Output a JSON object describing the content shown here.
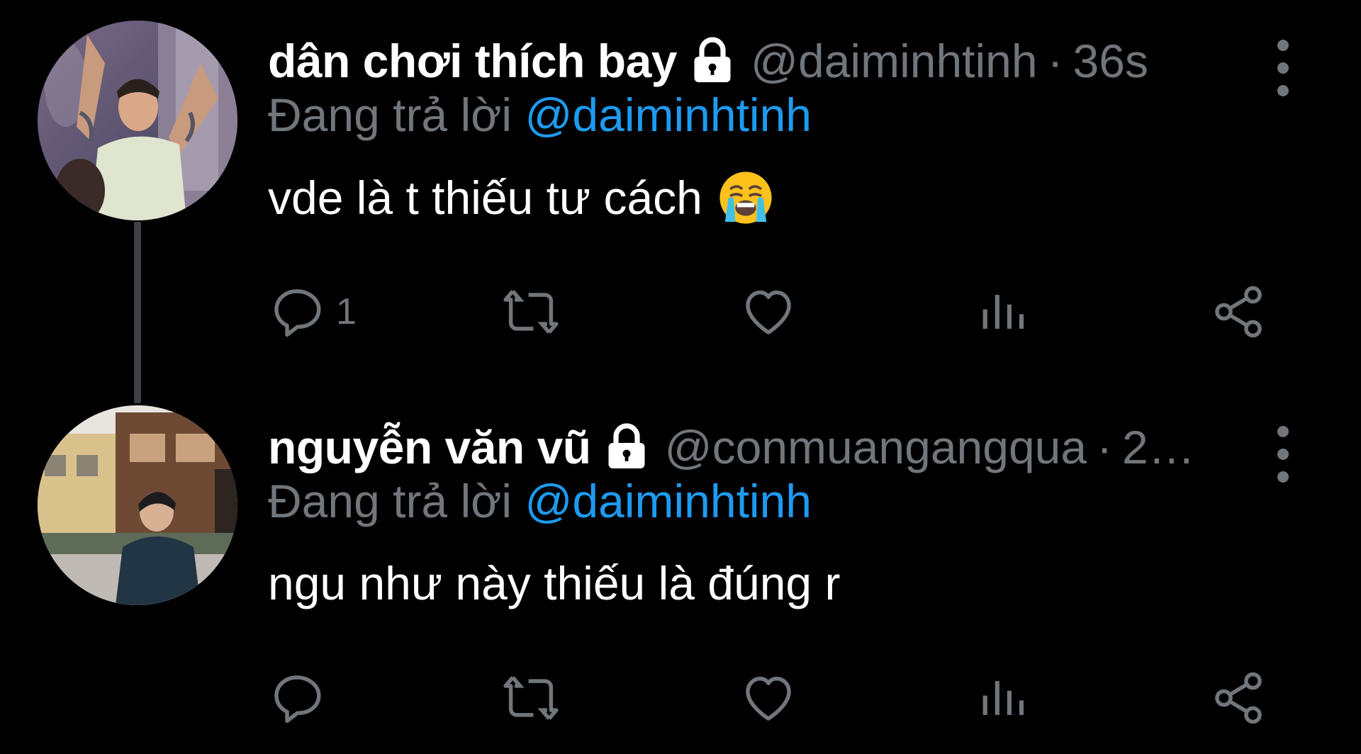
{
  "tweets": [
    {
      "display_name": "dân chơi thích bay",
      "handle": "@daiminhtinh",
      "separator": "·",
      "time": "36s",
      "reply_prefix": "Đang trả lời",
      "reply_to": "@daiminhtinh",
      "text": "vde là t thiếu tư cách",
      "emoji": "loudly-crying-face",
      "reply_count": "1",
      "protected": true
    },
    {
      "display_name": "nguyễn văn vũ",
      "handle": "@conmuangangqua",
      "separator": "·",
      "time": "2…",
      "reply_prefix": "Đang trả lời",
      "reply_to": "@daiminhtinh",
      "text": "ngu như này thiếu là đúng r",
      "reply_count": "",
      "protected": true
    }
  ],
  "icons": {
    "lock": "lock-icon",
    "more": "more-vertical-icon",
    "reply": "reply-icon",
    "retweet": "retweet-icon",
    "like": "heart-icon",
    "views": "views-icon",
    "share": "share-icon"
  },
  "colors": {
    "background": "#000000",
    "text": "#ffffff",
    "muted": "#71767b",
    "link": "#1d9bf0",
    "thread_line": "#3e4144"
  }
}
